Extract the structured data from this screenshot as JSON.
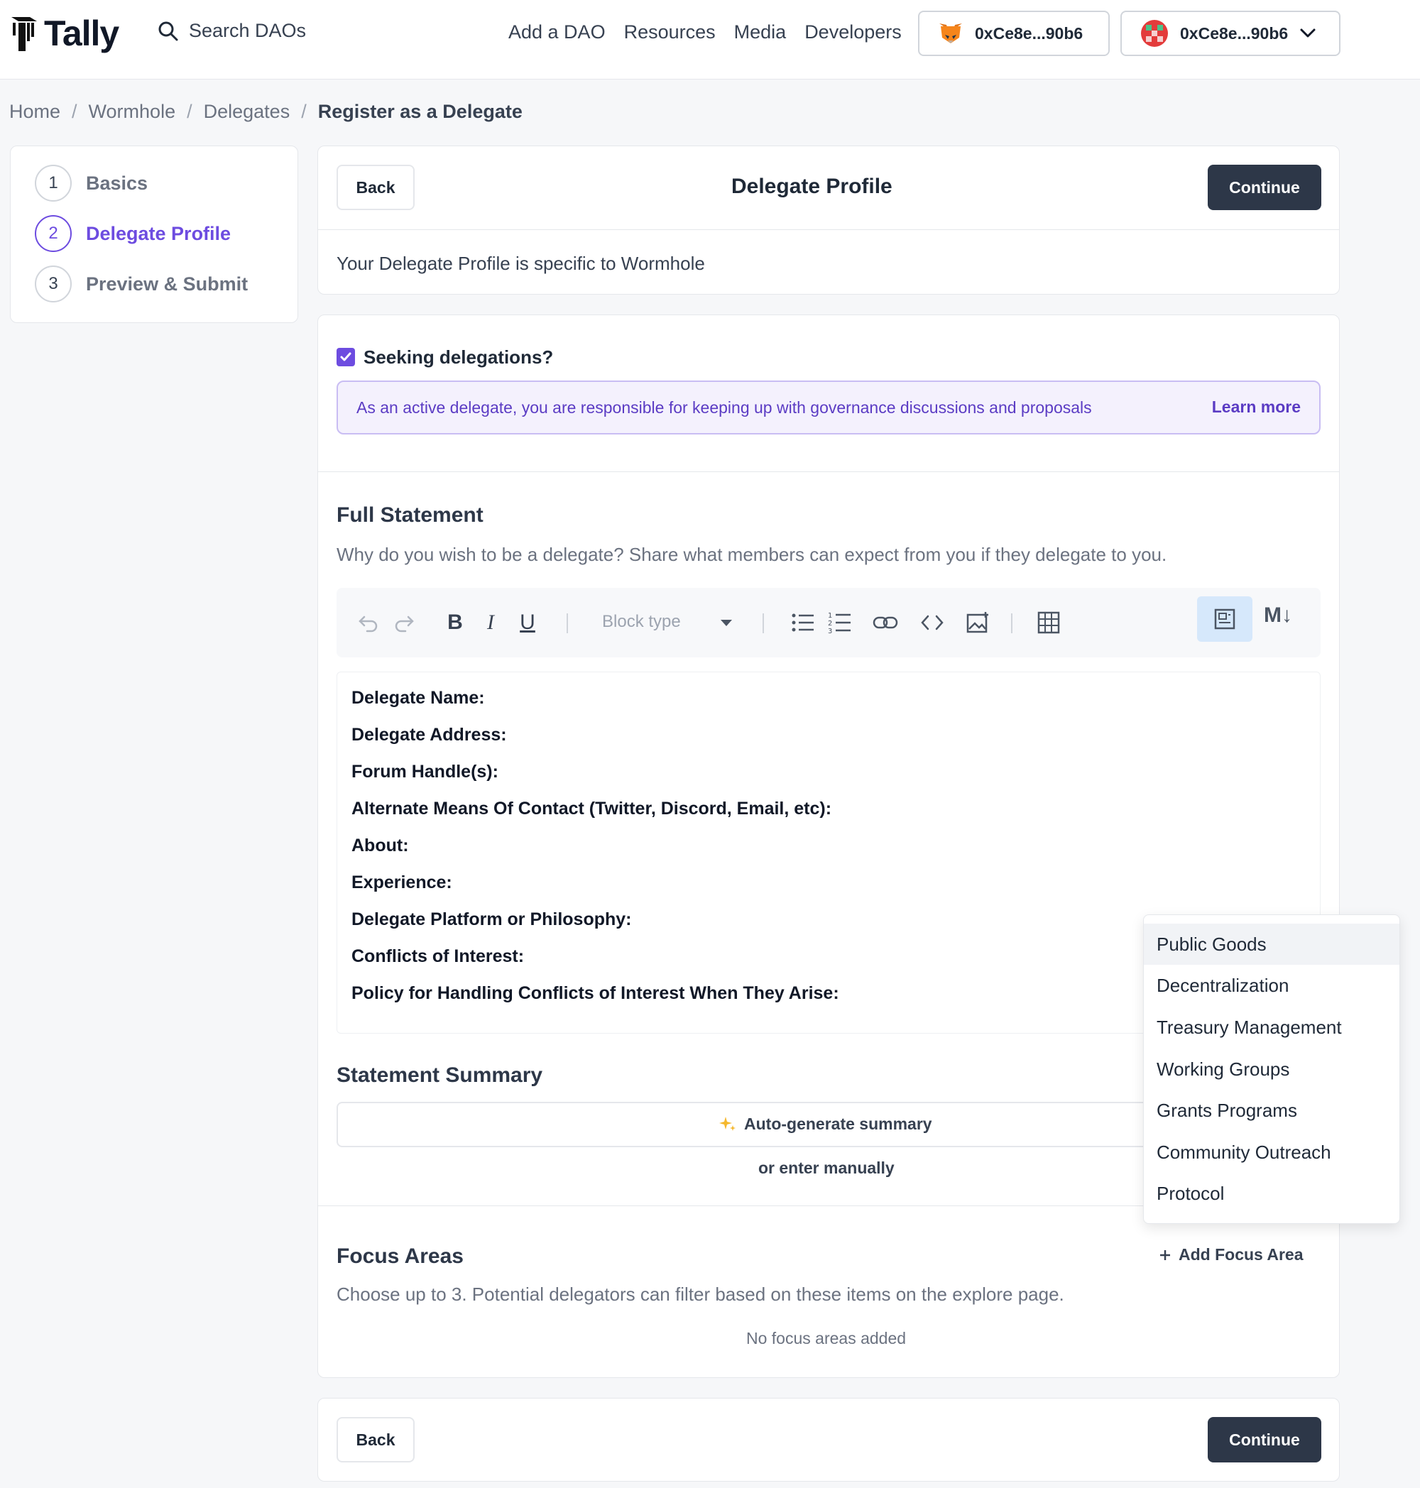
{
  "header": {
    "logo": "Tally",
    "search_placeholder": "Search DAOs",
    "nav": [
      "Add a DAO",
      "Resources",
      "Media",
      "Developers"
    ],
    "wallet_metamask": "0xCe8e...90b6",
    "wallet_account": "0xCe8e...90b6"
  },
  "breadcrumb": {
    "items": [
      "Home",
      "Wormhole",
      "Delegates"
    ],
    "separator": "/",
    "current": "Register as a Delegate"
  },
  "stepper": {
    "steps": [
      {
        "num": "1",
        "label": "Basics"
      },
      {
        "num": "2",
        "label": "Delegate Profile"
      },
      {
        "num": "3",
        "label": "Preview & Submit"
      }
    ],
    "active_index": 1
  },
  "profile": {
    "back_label": "Back",
    "title": "Delegate Profile",
    "continue_label": "Continue",
    "subtitle": "Your Delegate Profile is specific to Wormhole"
  },
  "seeking": {
    "label": "Seeking delegations?",
    "checked": true,
    "info": "As an active delegate, you are responsible for keeping up with governance discussions and proposals",
    "learn_more": "Learn more"
  },
  "statement": {
    "title": "Full Statement",
    "description": "Why do you wish to be a delegate? Share what members can expect from you if they delegate to you.",
    "toolbar": {
      "block_type_placeholder": "Block type",
      "markdown_label": "M↓",
      "icons": [
        "undo-icon",
        "redo-icon",
        "bold-icon",
        "italic-icon",
        "underline-icon",
        "bullet-list-icon",
        "numbered-list-icon",
        "link-icon",
        "code-icon",
        "image-icon",
        "table-icon",
        "rich-text-toggle-icon"
      ],
      "bold": "B",
      "italic": "I",
      "underline": "U"
    },
    "lines": [
      "Delegate Name:",
      "Delegate Address:",
      "Forum Handle(s):",
      "Alternate Means Of Contact (Twitter, Discord, Email, etc):",
      "About:",
      "Experience:",
      "Delegate Platform or Philosophy:",
      "Conflicts of Interest:",
      "Policy for Handling Conflicts of Interest When They Arise:"
    ]
  },
  "summary": {
    "title": "Statement Summary",
    "autogen_label": "Auto-generate summary",
    "manual_label": "or enter manually"
  },
  "focus": {
    "title": "Focus Areas",
    "add_label": "Add Focus Area",
    "description": "Choose up to 3. Potential delegators can filter based on these items on the explore page.",
    "empty": "No focus areas added",
    "options": [
      "Public Goods",
      "Decentralization",
      "Treasury Management",
      "Working Groups",
      "Grants Programs",
      "Community Outreach",
      "Protocol"
    ],
    "hovered_index": 0
  },
  "footer": {
    "back_label": "Back",
    "continue_label": "Continue"
  },
  "colors": {
    "accent": "#6d4ce0",
    "dark_button": "#2d3748",
    "info_bg": "#f4f1fd"
  }
}
